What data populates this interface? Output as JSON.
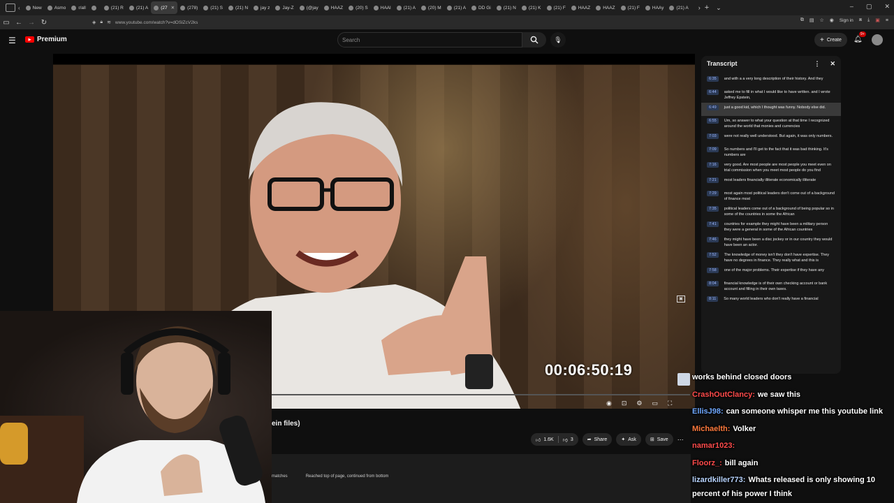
{
  "browser": {
    "tabs": [
      {
        "label": "New",
        "active": false
      },
      {
        "label": "Asmo",
        "active": false
      },
      {
        "label": "r/all",
        "active": false
      },
      {
        "label": "",
        "active": false
      },
      {
        "label": "(21) R",
        "active": false
      },
      {
        "label": "(21) A",
        "active": false
      },
      {
        "label": "(27",
        "active": true
      },
      {
        "label": "(278)",
        "active": false
      },
      {
        "label": "(21) S",
        "active": false
      },
      {
        "label": "(21) N",
        "active": false
      },
      {
        "label": "jay z",
        "active": false
      },
      {
        "label": "Jay-Z",
        "active": false
      },
      {
        "label": "(@jay",
        "active": false
      },
      {
        "label": "HAAZ",
        "active": false
      },
      {
        "label": "(20) S",
        "active": false
      },
      {
        "label": "HAAl",
        "active": false
      },
      {
        "label": "(21) A",
        "active": false
      },
      {
        "label": "(20) M",
        "active": false
      },
      {
        "label": "(21) A",
        "active": false
      },
      {
        "label": "DD Gi",
        "active": false
      },
      {
        "label": "(21) N",
        "active": false
      },
      {
        "label": "(21) K",
        "active": false
      },
      {
        "label": "(21) F",
        "active": false
      },
      {
        "label": "HAAZ",
        "active": false
      },
      {
        "label": "HAAZ",
        "active": false
      },
      {
        "label": "(21) F",
        "active": false
      },
      {
        "label": "HAAy",
        "active": false
      },
      {
        "label": "(21) A",
        "active": false
      }
    ],
    "url": "www.youtube.com/watch?v=dOSlZcV2ks",
    "signin": "Sign in"
  },
  "youtube": {
    "brand": "Premium",
    "search_placeholder": "Search",
    "create_label": "Create",
    "notif_badge": "9+"
  },
  "video": {
    "timestamp": "00:06:50:19",
    "title_fragment": "ein files)",
    "actions": {
      "like_count": "1.6K",
      "dislike_count": "3",
      "share": "Share",
      "ask": "Ask",
      "save": "Save"
    },
    "findbar": {
      "matches": "matches",
      "status": "Reached top of page, continued from bottom"
    }
  },
  "transcript": {
    "title": "Transcript",
    "rows": [
      {
        "time": "6:35",
        "text": "and with a a very long description of their history. And they"
      },
      {
        "time": "6:44",
        "text": "asked me to fill in what I would like to have written. and I wrote Jeffrey Epstein,"
      },
      {
        "time": "6:49",
        "text": "just a good kid, which I thought was funny. Nobody else did.",
        "highlight": true
      },
      {
        "time": "6:55",
        "text": "Um, so answer to what your question at that time I recognized around the world that monies and currencies"
      },
      {
        "time": "7:03",
        "text": "were not really well understood. But again, it was only numbers."
      },
      {
        "time": "7:09",
        "text": "So numbers and I'll get to the fact that it was bad thinking. It's numbers are"
      },
      {
        "time": "7:16",
        "text": "very good. Are most people are most people you meet even on trial commission when you meet most people do you find"
      },
      {
        "time": "7:21",
        "text": "most leaders financially illiterate economically illiterate"
      },
      {
        "time": "7:29",
        "text": "most again most political leaders don't come out of a background of finance most"
      },
      {
        "time": "7:35",
        "text": "political leaders come out of a background of being popular so in some of the countries in some the African"
      },
      {
        "time": "7:41",
        "text": "countries for example they might have been a military person they were a general in some of the African countries"
      },
      {
        "time": "7:46",
        "text": "they might have been a disc jockey or in our country they would have been an actor."
      },
      {
        "time": "7:52",
        "text": "The knowledge of money isn't they don't have expertise. They have no degrees in finance. They really what and this is"
      },
      {
        "time": "7:58",
        "text": "one of the major problems. Their expertise if they have any"
      },
      {
        "time": "8:04",
        "text": "financial knowledge is of their own checking account or bank account and filling in their own taxes."
      },
      {
        "time": "8:11",
        "text": "So many world leaders who don't really have a financial"
      }
    ]
  },
  "chat": [
    {
      "user": "",
      "user_color": "#ffffff",
      "message": "works behind closed doors"
    },
    {
      "user": "CrashOutClancy:",
      "user_color": "#ff4b4b",
      "message": "we saw this"
    },
    {
      "user": "EllisJ98:",
      "user_color": "#6fa8ff",
      "message": "can someone whisper me this youtube link"
    },
    {
      "user": "Michaelth:",
      "user_color": "#ff7a3d",
      "message": "Volker"
    },
    {
      "user": "namar1023:",
      "user_color": "#ff4b4b",
      "message": ""
    },
    {
      "user": "Floorz_:",
      "user_color": "#ff4b4b",
      "message": "bill again"
    },
    {
      "user": "lizardkiller773:",
      "user_color": "#b8d4ff",
      "message": "Whats released is only showing 10"
    },
    {
      "user": "",
      "user_color": "#ffffff",
      "message": "percent of his power I think"
    }
  ]
}
